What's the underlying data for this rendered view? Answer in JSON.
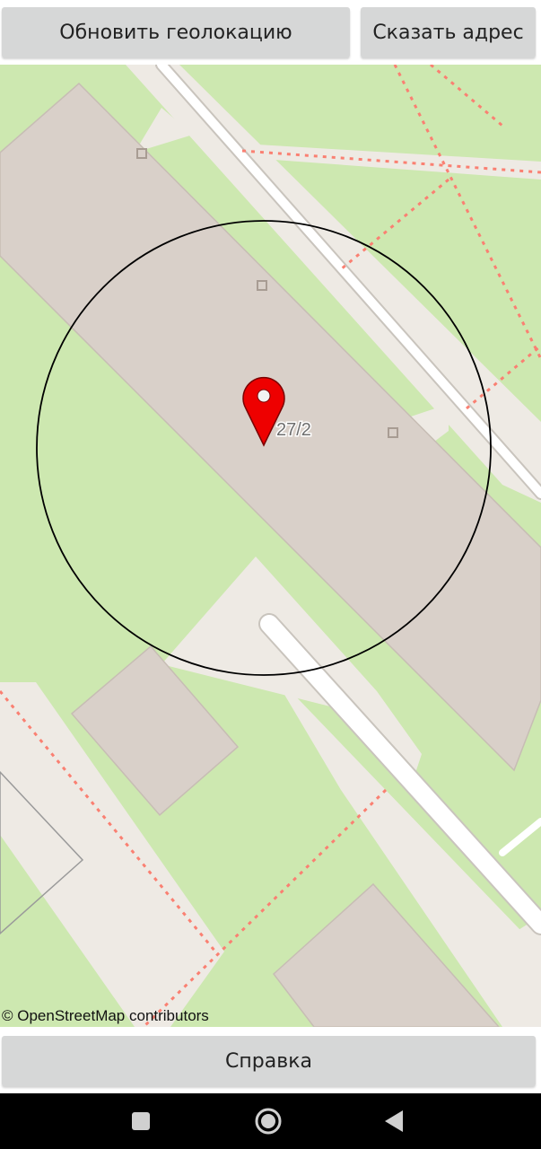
{
  "toolbar": {
    "update_geolocation_label": "Обновить геолокацию",
    "say_address_label": "Сказать адрес"
  },
  "map": {
    "house_number": "27/2",
    "attribution": "© OpenStreetMap contributors",
    "colors": {
      "grass": "#cde8b0",
      "building": "#d9d0c9",
      "road": "#ffffff",
      "footway": "#fa8072",
      "marker": "#ee0000"
    }
  },
  "footer": {
    "help_label": "Справка"
  },
  "navigation": {
    "recent_icon": "square-icon",
    "home_icon": "circle-icon",
    "back_icon": "triangle-back-icon"
  }
}
